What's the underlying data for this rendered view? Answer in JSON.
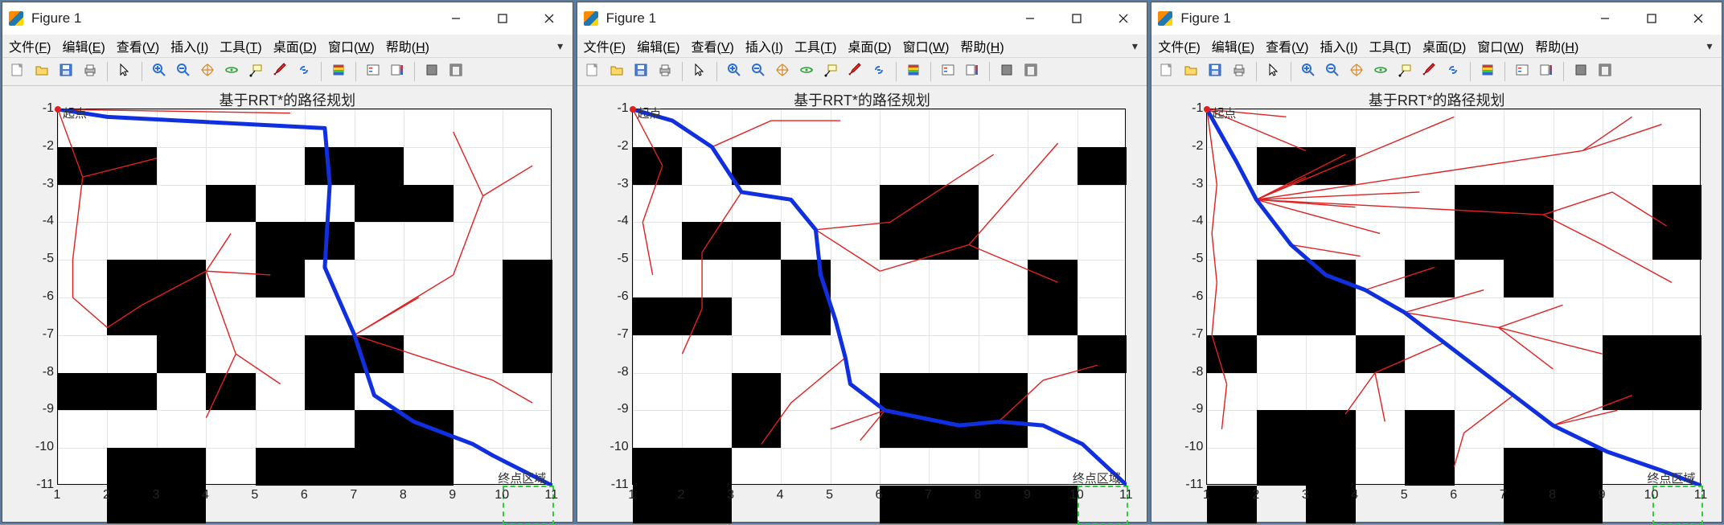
{
  "window_title": "Figure 1",
  "menus": [
    {
      "label": "文件",
      "ul": "F"
    },
    {
      "label": "编辑",
      "ul": "E"
    },
    {
      "label": "查看",
      "ul": "V"
    },
    {
      "label": "插入",
      "ul": "I"
    },
    {
      "label": "工具",
      "ul": "T"
    },
    {
      "label": "桌面",
      "ul": "D"
    },
    {
      "label": "窗口",
      "ul": "W"
    },
    {
      "label": "帮助",
      "ul": "H"
    }
  ],
  "toolbar_icons": [
    "new-figure",
    "open",
    "save",
    "print",
    "|",
    "pointer",
    "|",
    "zoom-in",
    "zoom-out",
    "pan",
    "rotate3d",
    "data-cursor",
    "brush",
    "link",
    "|",
    "colorbar",
    "|",
    "insert-legend",
    "insert-colorbar",
    "|",
    "hide-plot-tools",
    "show-plot-tools"
  ],
  "plot_title": "基于RRT*的路径规划",
  "start_label": "起点",
  "goal_label": "终点区域",
  "axes": {
    "xmin": 1,
    "xmax": 11,
    "ymin": -11,
    "ymax": -1,
    "xticks": [
      1,
      2,
      3,
      4,
      5,
      6,
      7,
      8,
      9,
      10,
      11
    ],
    "yticks": [
      -1,
      -2,
      -3,
      -4,
      -5,
      -6,
      -7,
      -8,
      -9,
      -10,
      -11
    ]
  },
  "chart_data": [
    {
      "type": "pathplanning",
      "title": "基于RRT*的路径规划",
      "xlim": [
        1,
        11
      ],
      "ylim": [
        -11,
        -1
      ],
      "obstacles": [
        [
          1,
          -2,
          2,
          1
        ],
        [
          6,
          -2,
          2,
          1
        ],
        [
          4,
          -3,
          1,
          1
        ],
        [
          7,
          -3,
          2,
          1
        ],
        [
          2,
          -5,
          2,
          2
        ],
        [
          5,
          -4,
          2,
          1
        ],
        [
          5,
          -5,
          1,
          1
        ],
        [
          10,
          -5,
          1,
          2
        ],
        [
          3,
          -7,
          1,
          1
        ],
        [
          6,
          -7,
          2,
          1
        ],
        [
          1,
          -8,
          2,
          1
        ],
        [
          4,
          -8,
          1,
          1
        ],
        [
          6,
          -8,
          1,
          1
        ],
        [
          7,
          -9,
          2,
          2
        ],
        [
          10,
          -7,
          1,
          1
        ],
        [
          2,
          -10,
          2,
          2
        ],
        [
          5,
          -10,
          2,
          1
        ]
      ],
      "path": [
        [
          1,
          -1
        ],
        [
          2.0,
          -1.2
        ],
        [
          6.4,
          -1.5
        ],
        [
          6.5,
          -3.0
        ],
        [
          6.4,
          -5.2
        ],
        [
          7.0,
          -7.0
        ],
        [
          7.4,
          -8.6
        ],
        [
          8.2,
          -9.3
        ],
        [
          9.4,
          -9.9
        ],
        [
          9.8,
          -10.2
        ],
        [
          10.4,
          -10.6
        ],
        [
          11,
          -11
        ]
      ],
      "tree_edges": [
        [
          [
            1,
            -1
          ],
          [
            1.5,
            -2.8
          ]
        ],
        [
          [
            1,
            -1
          ],
          [
            5.7,
            -1.1
          ]
        ],
        [
          [
            1.5,
            -2.8
          ],
          [
            1.3,
            -5.0
          ]
        ],
        [
          [
            1.5,
            -2.8
          ],
          [
            3.0,
            -2.3
          ]
        ],
        [
          [
            1.3,
            -5.0
          ],
          [
            1.3,
            -6.0
          ]
        ],
        [
          [
            1.3,
            -6.0
          ],
          [
            2.0,
            -6.8
          ]
        ],
        [
          [
            2.0,
            -6.8
          ],
          [
            2.7,
            -6.2
          ]
        ],
        [
          [
            2.7,
            -6.2
          ],
          [
            4.0,
            -5.3
          ]
        ],
        [
          [
            4.0,
            -5.3
          ],
          [
            4.5,
            -4.3
          ]
        ],
        [
          [
            4.0,
            -5.3
          ],
          [
            5.3,
            -5.4
          ]
        ],
        [
          [
            4.0,
            -5.3
          ],
          [
            4.6,
            -7.5
          ]
        ],
        [
          [
            4.6,
            -7.5
          ],
          [
            4.0,
            -9.2
          ]
        ],
        [
          [
            4.6,
            -7.5
          ],
          [
            5.5,
            -8.3
          ]
        ],
        [
          [
            7.0,
            -7.0
          ],
          [
            9.0,
            -5.4
          ]
        ],
        [
          [
            7.0,
            -7.0
          ],
          [
            8.3,
            -6.0
          ]
        ],
        [
          [
            7.0,
            -7.0
          ],
          [
            9.8,
            -8.2
          ]
        ],
        [
          [
            9.8,
            -8.2
          ],
          [
            10.6,
            -8.8
          ]
        ],
        [
          [
            9.0,
            -5.4
          ],
          [
            9.6,
            -3.3
          ]
        ],
        [
          [
            9.6,
            -3.3
          ],
          [
            10.6,
            -2.5
          ]
        ],
        [
          [
            9.6,
            -3.3
          ],
          [
            9.0,
            -1.6
          ]
        ]
      ],
      "goal_region": [
        10,
        -11,
        1,
        1
      ]
    },
    {
      "type": "pathplanning",
      "title": "基于RRT*的路径规划",
      "xlim": [
        1,
        11
      ],
      "ylim": [
        -11,
        -1
      ],
      "obstacles": [
        [
          1,
          -2,
          1,
          1
        ],
        [
          3,
          -2,
          1,
          1
        ],
        [
          6,
          -3,
          2,
          2
        ],
        [
          10,
          -2,
          1,
          1
        ],
        [
          2,
          -4,
          2,
          1
        ],
        [
          4,
          -5,
          1,
          2
        ],
        [
          9,
          -5,
          1,
          2
        ],
        [
          1,
          -6,
          2,
          1
        ],
        [
          3,
          -8,
          1,
          2
        ],
        [
          6,
          -8,
          3,
          2
        ],
        [
          10,
          -7,
          1,
          1
        ],
        [
          1,
          -10,
          2,
          2
        ],
        [
          6,
          -11,
          4,
          1
        ]
      ],
      "path": [
        [
          1,
          -1
        ],
        [
          1.8,
          -1.3
        ],
        [
          2.6,
          -2.0
        ],
        [
          3.2,
          -3.2
        ],
        [
          4.2,
          -3.4
        ],
        [
          4.7,
          -4.2
        ],
        [
          4.8,
          -5.4
        ],
        [
          5.1,
          -6.6
        ],
        [
          5.3,
          -7.6
        ],
        [
          5.4,
          -8.3
        ],
        [
          6.1,
          -9.0
        ],
        [
          7.6,
          -9.4
        ],
        [
          8.4,
          -9.3
        ],
        [
          9.3,
          -9.4
        ],
        [
          10.1,
          -9.9
        ],
        [
          11,
          -11
        ]
      ],
      "tree_edges": [
        [
          [
            1,
            -1
          ],
          [
            1.6,
            -2.5
          ]
        ],
        [
          [
            1.6,
            -2.5
          ],
          [
            1.2,
            -4.0
          ]
        ],
        [
          [
            1.2,
            -4.0
          ],
          [
            1.4,
            -5.4
          ]
        ],
        [
          [
            2.6,
            -2.0
          ],
          [
            3.8,
            -1.3
          ]
        ],
        [
          [
            3.8,
            -1.3
          ],
          [
            5.2,
            -1.3
          ]
        ],
        [
          [
            3.2,
            -3.2
          ],
          [
            2.4,
            -4.8
          ]
        ],
        [
          [
            2.4,
            -4.8
          ],
          [
            2.4,
            -6.3
          ]
        ],
        [
          [
            2.4,
            -6.3
          ],
          [
            2.0,
            -7.5
          ]
        ],
        [
          [
            4.7,
            -4.2
          ],
          [
            6.2,
            -4.0
          ]
        ],
        [
          [
            4.7,
            -4.2
          ],
          [
            6.0,
            -5.3
          ]
        ],
        [
          [
            6.0,
            -5.3
          ],
          [
            7.8,
            -4.6
          ]
        ],
        [
          [
            7.8,
            -4.6
          ],
          [
            8.8,
            -3.1
          ]
        ],
        [
          [
            8.8,
            -3.1
          ],
          [
            9.6,
            -1.9
          ]
        ],
        [
          [
            7.8,
            -4.6
          ],
          [
            9.6,
            -5.6
          ]
        ],
        [
          [
            5.3,
            -7.6
          ],
          [
            4.2,
            -8.8
          ]
        ],
        [
          [
            6.1,
            -9.0
          ],
          [
            5.6,
            -9.8
          ]
        ],
        [
          [
            6.1,
            -9.0
          ],
          [
            5.0,
            -9.5
          ]
        ],
        [
          [
            8.4,
            -9.3
          ],
          [
            9.3,
            -8.2
          ]
        ],
        [
          [
            9.3,
            -8.2
          ],
          [
            10.4,
            -7.8
          ]
        ],
        [
          [
            4.2,
            -8.8
          ],
          [
            3.6,
            -9.9
          ]
        ],
        [
          [
            6.2,
            -4.0
          ],
          [
            8.3,
            -2.2
          ]
        ]
      ],
      "goal_region": [
        10,
        -11,
        1,
        1
      ]
    },
    {
      "type": "pathplanning",
      "title": "基于RRT*的路径规划",
      "xlim": [
        1,
        11
      ],
      "ylim": [
        -11,
        -1
      ],
      "obstacles": [
        [
          2,
          -2,
          2,
          1
        ],
        [
          6,
          -3,
          2,
          2
        ],
        [
          10,
          -3,
          1,
          2
        ],
        [
          2,
          -5,
          2,
          2
        ],
        [
          5,
          -5,
          1,
          1
        ],
        [
          7,
          -5,
          1,
          1
        ],
        [
          1,
          -7,
          1,
          1
        ],
        [
          4,
          -7,
          1,
          1
        ],
        [
          9,
          -7,
          2,
          2
        ],
        [
          2,
          -9,
          2,
          2
        ],
        [
          5,
          -9,
          1,
          2
        ],
        [
          7,
          -10,
          2,
          2
        ],
        [
          1,
          -11,
          1,
          1
        ],
        [
          3,
          -11,
          1,
          1
        ]
      ],
      "path": [
        [
          1,
          -1
        ],
        [
          1.6,
          -2.4
        ],
        [
          2.0,
          -3.4
        ],
        [
          2.7,
          -4.6
        ],
        [
          3.4,
          -5.4
        ],
        [
          4.2,
          -5.8
        ],
        [
          5.0,
          -6.4
        ],
        [
          5.8,
          -7.2
        ],
        [
          6.4,
          -7.8
        ],
        [
          7.2,
          -8.6
        ],
        [
          8.0,
          -9.4
        ],
        [
          9.1,
          -10.1
        ],
        [
          10.2,
          -10.6
        ],
        [
          11,
          -11
        ]
      ],
      "tree_edges": [
        [
          [
            1,
            -1
          ],
          [
            2.6,
            -1.2
          ]
        ],
        [
          [
            1,
            -1
          ],
          [
            1.2,
            -3.0
          ]
        ],
        [
          [
            1,
            -1
          ],
          [
            3.0,
            -2.1
          ]
        ],
        [
          [
            1.2,
            -3.0
          ],
          [
            1.1,
            -4.3
          ]
        ],
        [
          [
            1.1,
            -4.3
          ],
          [
            1.2,
            -5.6
          ]
        ],
        [
          [
            1.2,
            -5.6
          ],
          [
            1.1,
            -7.0
          ]
        ],
        [
          [
            1.1,
            -7.0
          ],
          [
            1.4,
            -8.3
          ]
        ],
        [
          [
            1.4,
            -8.3
          ],
          [
            1.3,
            -9.5
          ]
        ],
        [
          [
            2.0,
            -3.4
          ],
          [
            3.0,
            -2.8
          ]
        ],
        [
          [
            2.0,
            -3.4
          ],
          [
            4.0,
            -3.6
          ]
        ],
        [
          [
            2.0,
            -3.4
          ],
          [
            3.8,
            -2.2
          ]
        ],
        [
          [
            2.0,
            -3.4
          ],
          [
            4.5,
            -4.3
          ]
        ],
        [
          [
            2.0,
            -3.4
          ],
          [
            5.3,
            -3.2
          ]
        ],
        [
          [
            2.0,
            -3.4
          ],
          [
            6.0,
            -1.2
          ]
        ],
        [
          [
            2.0,
            -3.4
          ],
          [
            7.8,
            -3.8
          ]
        ],
        [
          [
            2.0,
            -3.4
          ],
          [
            8.6,
            -2.1
          ]
        ],
        [
          [
            2.7,
            -4.6
          ],
          [
            4.1,
            -4.9
          ]
        ],
        [
          [
            4.2,
            -5.8
          ],
          [
            5.6,
            -5.2
          ]
        ],
        [
          [
            5.0,
            -6.4
          ],
          [
            6.6,
            -5.8
          ]
        ],
        [
          [
            5.0,
            -6.4
          ],
          [
            6.9,
            -6.8
          ]
        ],
        [
          [
            6.9,
            -6.8
          ],
          [
            8.2,
            -6.2
          ]
        ],
        [
          [
            6.9,
            -6.8
          ],
          [
            8.0,
            -7.9
          ]
        ],
        [
          [
            6.9,
            -6.8
          ],
          [
            9.0,
            -7.5
          ]
        ],
        [
          [
            5.8,
            -7.2
          ],
          [
            4.4,
            -8.0
          ]
        ],
        [
          [
            4.4,
            -8.0
          ],
          [
            4.6,
            -9.3
          ]
        ],
        [
          [
            4.4,
            -8.0
          ],
          [
            3.8,
            -9.1
          ]
        ],
        [
          [
            7.2,
            -8.6
          ],
          [
            6.2,
            -9.6
          ]
        ],
        [
          [
            6.2,
            -9.6
          ],
          [
            6.0,
            -10.5
          ]
        ],
        [
          [
            8.0,
            -9.4
          ],
          [
            9.6,
            -8.6
          ]
        ],
        [
          [
            8.0,
            -9.4
          ],
          [
            9.3,
            -9.0
          ]
        ],
        [
          [
            7.8,
            -3.8
          ],
          [
            9.0,
            -4.6
          ]
        ],
        [
          [
            7.8,
            -3.8
          ],
          [
            9.2,
            -3.2
          ]
        ],
        [
          [
            9.2,
            -3.2
          ],
          [
            10.3,
            -4.1
          ]
        ],
        [
          [
            9.0,
            -4.6
          ],
          [
            10.4,
            -5.6
          ]
        ],
        [
          [
            8.6,
            -2.1
          ],
          [
            9.6,
            -1.2
          ]
        ],
        [
          [
            8.6,
            -2.1
          ],
          [
            10.2,
            -1.4
          ]
        ]
      ],
      "goal_region": [
        10,
        -11,
        1,
        1
      ]
    }
  ]
}
